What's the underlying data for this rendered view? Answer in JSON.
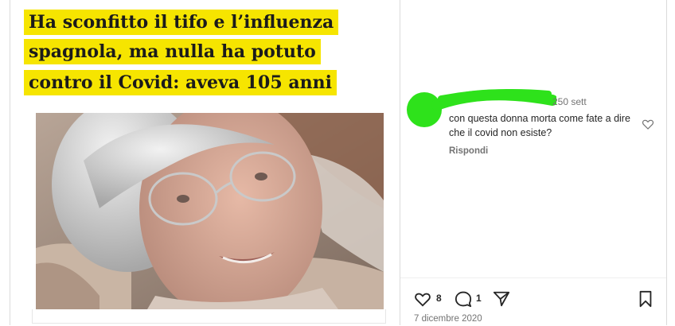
{
  "headline": {
    "line1": "Ha sconfitto il tifo e l’influenza",
    "line2": "spagnola, ma nulla ha potuto",
    "line3": "contro il Covid: aveva 105 anni",
    "highlight_color": "#f6e500"
  },
  "comment": {
    "time": "250 sett",
    "text": "con questa donna morta come fate a dire che il covid non esiste?",
    "reply_label": "Rispondi",
    "redaction_color": "#2ee21b"
  },
  "actions": {
    "likes": "8",
    "comments": "1",
    "date": "7 dicembre 2020"
  },
  "icons": {
    "like": "heart-icon",
    "comment": "speech-bubble-icon",
    "share": "paper-plane-icon",
    "save": "bookmark-icon",
    "comment_like": "heart-icon"
  }
}
